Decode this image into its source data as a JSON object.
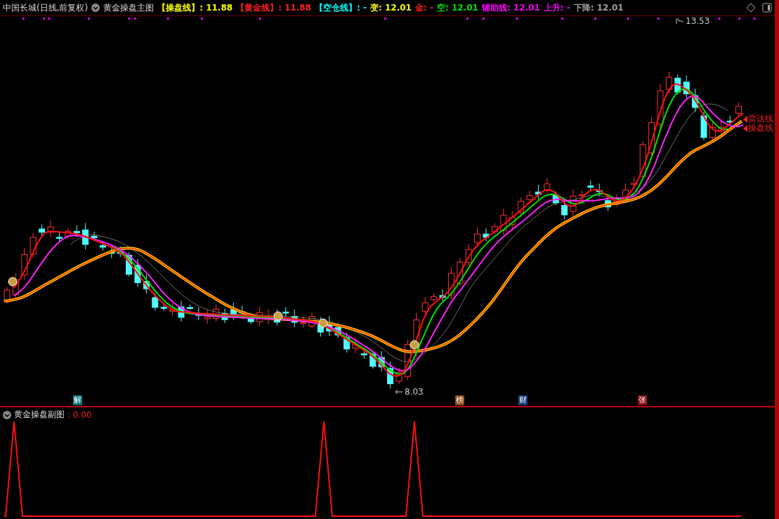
{
  "header": {
    "security": "中国长城(日线,前复权)",
    "indicator": "黄金操盘主图",
    "items": [
      {
        "label": "【操盘线】",
        "value": ": 11.88",
        "color": "#ffff00"
      },
      {
        "label": "【黄金线】",
        "value": ": 11.88",
        "color": "#ff2020"
      },
      {
        "label": "【空仓线】",
        "value": ": -",
        "color": "#00ffff"
      },
      {
        "label": "变",
        "value": ": 12.01",
        "color": "#ffff00"
      },
      {
        "label": "金",
        "value": ": -",
        "color": "#ff2020"
      },
      {
        "label": "空",
        "value": ": 12.01",
        "color": "#00e000"
      },
      {
        "label": "辅助线",
        "value": ": 12.01",
        "color": "#ff00ff"
      },
      {
        "label": "上升",
        "value": ": -",
        "color": "#ff00ff"
      },
      {
        "label": "下降",
        "value": ": 12.01",
        "color": "#a0a0a0"
      }
    ]
  },
  "main_chart": {
    "high_label": "13.53",
    "low_label": "8.03",
    "line_labels": [
      {
        "label": "雷达线"
      },
      {
        "label": "操盘线"
      }
    ],
    "markers": [
      {
        "label": "解",
        "color": "#007878"
      },
      {
        "label": "榜",
        "color": "#8a4a10"
      },
      {
        "label": "财",
        "color": "#14407a"
      },
      {
        "label": "张",
        "color": "#8a0a0a"
      }
    ]
  },
  "sub_chart": {
    "title": "黄金操盘副图",
    "value": ": 0.00"
  }
}
